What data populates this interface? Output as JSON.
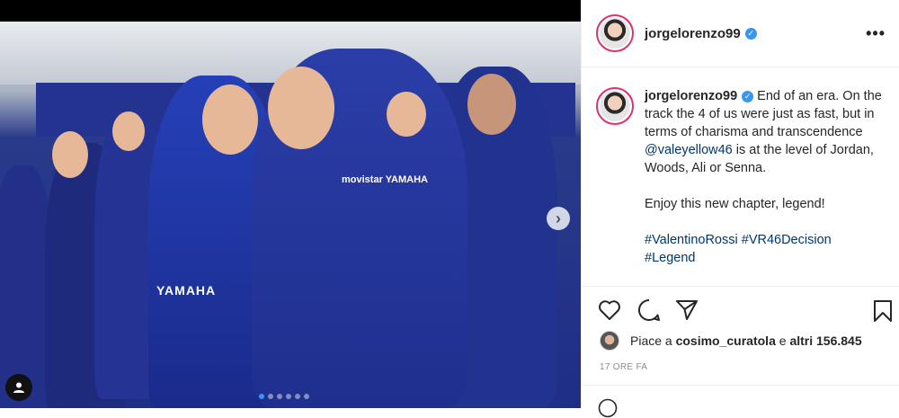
{
  "post": {
    "username": "jorgelorenzo99",
    "verified_icon": "verified-badge-icon",
    "more_icon": "more-options-icon",
    "caption": {
      "username": "jorgelorenzo99",
      "text_1": "End of an era. On the track the 4 of us were just as fast, but in terms of charisma and transcendence ",
      "mention": "@valeyellow46",
      "text_2": " is at the level of Jordan, Woods, Ali or Senna.",
      "paragraph_2": "Enjoy this new chapter, legend!",
      "hashtag_1": "#ValentinoRossi",
      "hashtag_2": "#VR46Decision",
      "hashtag_3": "#Legend"
    },
    "likes": {
      "prefix": "Piace a ",
      "user": "cosimo_curatola",
      "middle": " e ",
      "others": "altri 156.845"
    },
    "timestamp": "17 ORE FA"
  },
  "media": {
    "shirt_text": "movistar YAMAHA",
    "suit_text": "YAMAHA",
    "carousel_dots": 6,
    "active_dot": 0
  },
  "colors": {
    "accent": "#3897f0",
    "link": "#00376b",
    "muted": "#8e8e8e",
    "story_ring": "#e1306c"
  }
}
